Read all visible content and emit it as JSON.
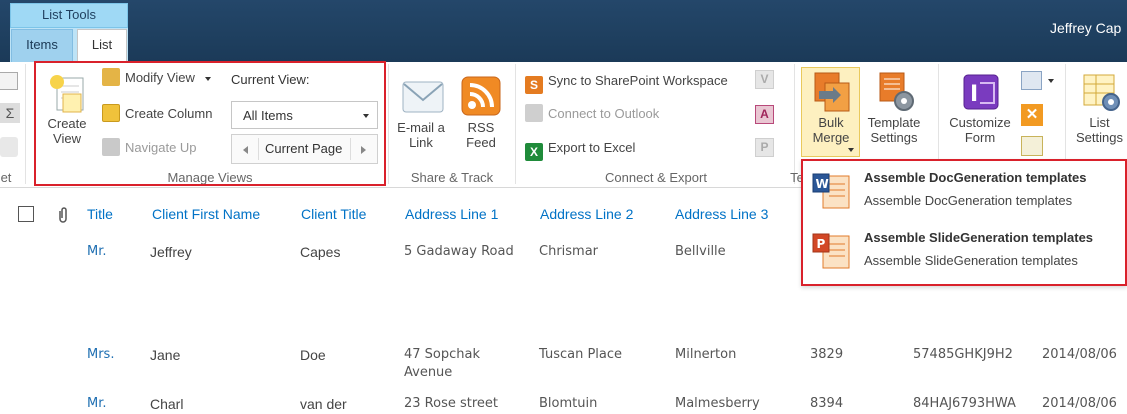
{
  "header": {
    "context_label": "List Tools",
    "tabs": [
      {
        "label": "Items"
      },
      {
        "label": "List"
      }
    ],
    "user": "Jeffrey Cap"
  },
  "ribbon": {
    "manage_views": {
      "label": "Manage Views",
      "create_view": "Create\nView",
      "modify_view": "Modify View",
      "create_column": "Create Column",
      "navigate_up": "Navigate Up",
      "current_view_label": "Current View:",
      "current_view_value": "All Items",
      "current_page": "Current Page"
    },
    "share_track": {
      "label": "Share & Track",
      "email_link": "E-mail a\nLink",
      "rss_feed": "RSS\nFeed"
    },
    "connect_export": {
      "label": "Connect & Export",
      "sync": "Sync to SharePoint Workspace",
      "connect_outlook": "Connect to Outlook",
      "export_excel": "Export to Excel"
    },
    "bulk_merge": "Bulk\nMerge",
    "template_settings": "Template\nSettings",
    "customize_form": "Customize\nForm",
    "list_settings": "List\nSettings",
    "left_partial_label": "et",
    "te_partial_label": "Te"
  },
  "menu": {
    "items": [
      {
        "title": "Assemble DocGeneration templates",
        "desc": "Assemble DocGeneration templates"
      },
      {
        "title": "Assemble SlideGeneration templates",
        "desc": "Assemble SlideGeneration templates"
      }
    ]
  },
  "list": {
    "columns": [
      "Title",
      "Client First Name",
      "Client Title",
      "Address Line 1",
      "Address Line 2",
      "Address Line 3"
    ],
    "rows": [
      {
        "title": "Mr.",
        "first": "Jeffrey",
        "ctitle": "Capes",
        "a1": "5 Gadaway Road",
        "a1b": "",
        "a2": "Chrismar",
        "a3": "Bellville",
        "c7": "",
        "c8": "",
        "c9": ""
      },
      {
        "title": "Mrs.",
        "first": "Jane",
        "ctitle": "Doe",
        "a1": "47 Sopchak",
        "a1b": "Avenue",
        "a2": "Tuscan Place",
        "a3": "Milnerton",
        "c7": "3829",
        "c8": "57485GHKJ9H2",
        "c9": "2014/08/06"
      },
      {
        "title": "Mr.",
        "first": "Charl",
        "ctitle": "van der",
        "a1": "23 Rose street",
        "a1b": "",
        "a2": "Blomtuin",
        "a3": "Malmesberry",
        "c7": "8394",
        "c8": "84HAJ6793HWA",
        "c9": "2014/08/06"
      }
    ]
  },
  "colors": {
    "topbar": "#1f3f5e",
    "highlight_border": "#d9212b",
    "link_blue": "#0072c6"
  }
}
